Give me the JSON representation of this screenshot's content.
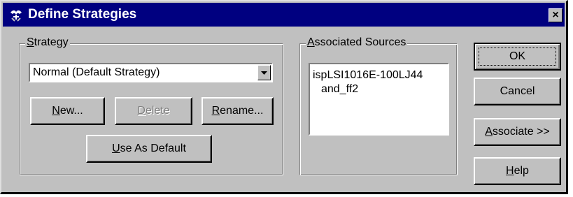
{
  "window": {
    "title": "Define Strategies",
    "close_glyph": "×",
    "icon": "strategy-app-icon"
  },
  "strategy_group": {
    "legend": "Strategy",
    "select": {
      "value": "Normal (Default Strategy)"
    },
    "buttons": {
      "new_label": "New...",
      "delete_label": "Delete",
      "rename_label": "Rename...",
      "use_default_label": "Use As Default"
    }
  },
  "sources_group": {
    "legend": "Associated Sources",
    "items": [
      "ispLSI1016E-100LJ44",
      "and_ff2"
    ]
  },
  "actions": {
    "ok_label": "OK",
    "cancel_label": "Cancel",
    "associate_label": "Associate >>",
    "help_label": "Help"
  },
  "colors": {
    "title_bar": "#000080",
    "face": "#c0c0c0",
    "disabled_text": "#808080"
  }
}
